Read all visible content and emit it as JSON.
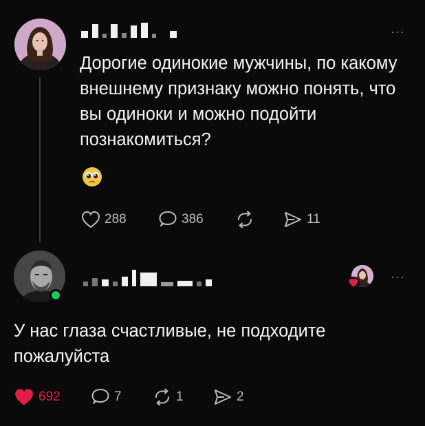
{
  "post": {
    "text": "Дорогие одинокие мужчины, по какому внешнему признаку можно понять, что вы одиноки и можно подойти познакомиться?",
    "emoji": "🥹",
    "more": "···",
    "likes": "288",
    "comments": "386",
    "shares": "11"
  },
  "reply": {
    "text": "У нас глаза счастливые, не подходите пожалуйста",
    "more": "···",
    "likes": "692",
    "comments": "7",
    "reposts": "1",
    "shares": "2"
  },
  "colors": {
    "background": "#0a0a0a",
    "text": "#f4f4f4",
    "muted": "#bdbdbd",
    "like_red": "#e11d48",
    "online_green": "#22c55e"
  }
}
